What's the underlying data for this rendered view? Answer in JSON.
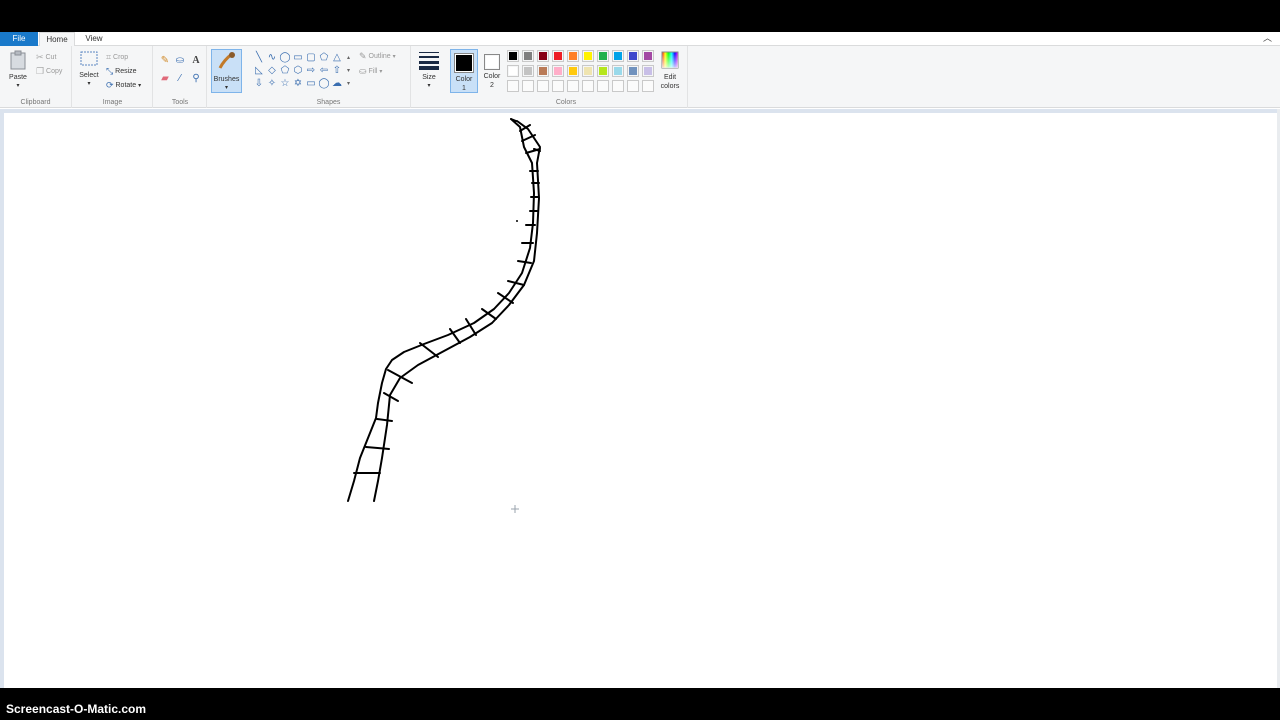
{
  "tabs": {
    "file": "File",
    "home": "Home",
    "view": "View"
  },
  "clipboard": {
    "paste": "Paste",
    "cut": "Cut",
    "copy": "Copy",
    "label": "Clipboard"
  },
  "image": {
    "select": "Select",
    "crop": "Crop",
    "resize": "Resize",
    "rotate": "Rotate",
    "label": "Image"
  },
  "tools": {
    "label": "Tools"
  },
  "brushes": {
    "label": "Brushes"
  },
  "shapes": {
    "outline": "Outline",
    "fill": "Fill",
    "label": "Shapes"
  },
  "size": {
    "label": "Size"
  },
  "color1": {
    "line1": "Color",
    "line2": "1"
  },
  "color2": {
    "line1": "Color",
    "line2": "2"
  },
  "colors": {
    "label": "Colors",
    "edit_line1": "Edit",
    "edit_line2": "colors",
    "selected_color1": "#000000",
    "selected_color2": "#ffffff",
    "row1": [
      "#000000",
      "#7f7f7f",
      "#880015",
      "#ed1c24",
      "#ff7f27",
      "#fff200",
      "#22b14c",
      "#00a2e8",
      "#3f48cc",
      "#a349a4"
    ],
    "row2": [
      "#ffffff",
      "#c3c3c3",
      "#b97a57",
      "#ffaec9",
      "#ffc90e",
      "#efe4b0",
      "#b5e61d",
      "#99d9ea",
      "#7092be",
      "#c8bfe7"
    ]
  },
  "watermark": "Screencast-O-Matic.com"
}
